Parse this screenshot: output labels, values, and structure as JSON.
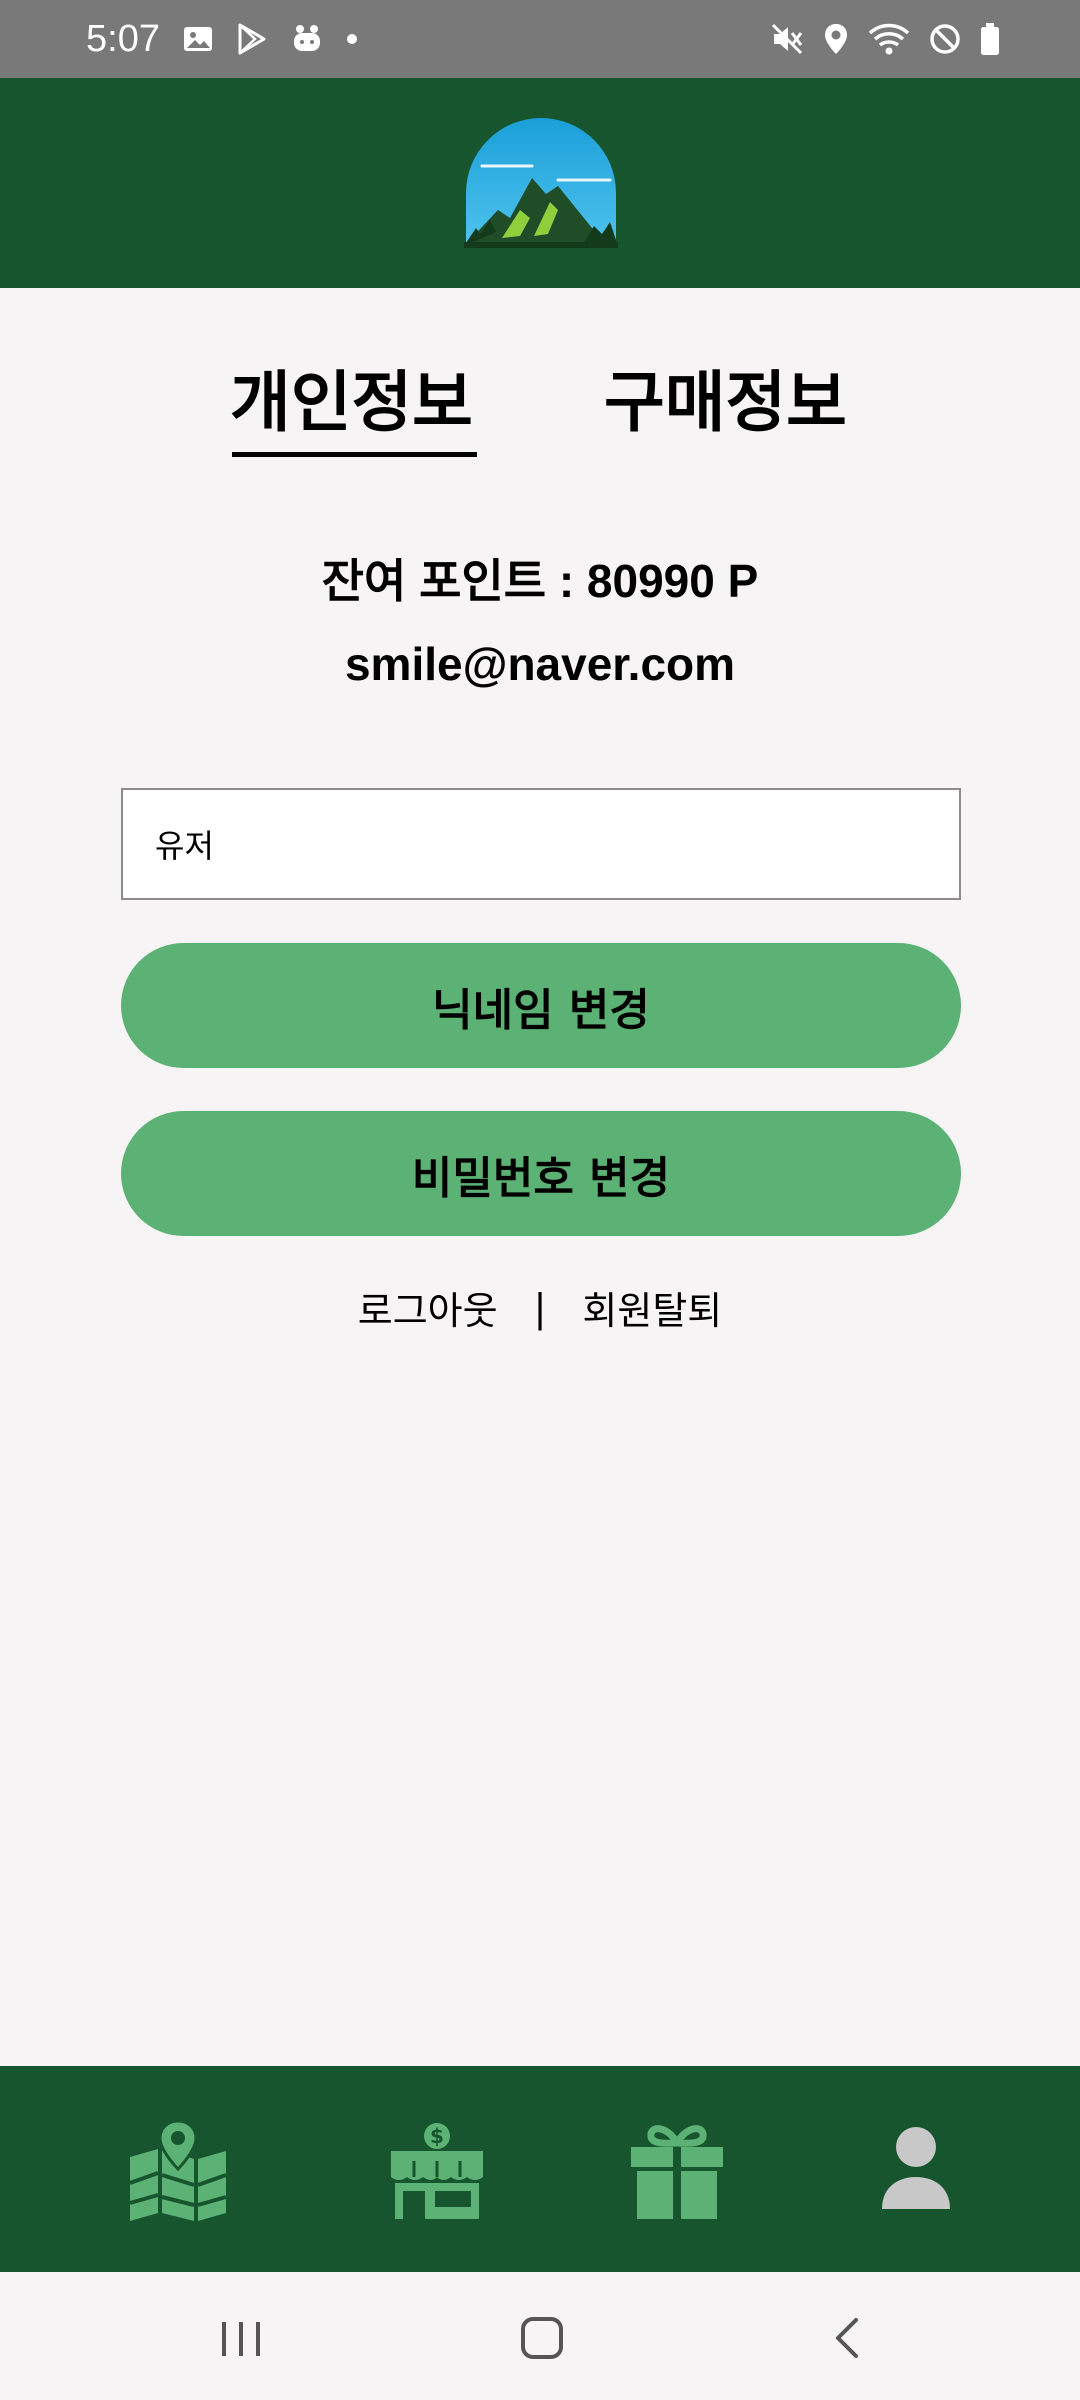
{
  "status_bar": {
    "time": "5:07",
    "left_icons": [
      "image-icon",
      "play-store-icon",
      "app-notification-icon",
      "dot-icon"
    ],
    "right_icons": [
      "mute-icon",
      "location-icon",
      "wifi-icon",
      "do-not-disturb-icon",
      "battery-icon"
    ]
  },
  "header": {
    "logo": "mountain-logo",
    "background_color": "#17552f"
  },
  "tabs": [
    {
      "label": "개인정보",
      "active": true
    },
    {
      "label": "구매정보",
      "active": false
    }
  ],
  "profile": {
    "points_text": "잔여 포인트 : 80990 P",
    "email": "smile@naver.com"
  },
  "nickname_input": {
    "value": "유저"
  },
  "buttons": {
    "change_nickname": "닉네임 변경",
    "change_password": "비밀번호 변경",
    "color": "#5cb274"
  },
  "links": {
    "logout": "로그아웃",
    "separator": "|",
    "withdraw": "회원탈퇴"
  },
  "bottom_nav": {
    "items": [
      "map-icon",
      "store-icon",
      "gift-icon",
      "profile-icon"
    ],
    "active": "profile-icon",
    "icon_color": "#5cb274",
    "active_icon_color": "#c8c8c8"
  },
  "system_nav": [
    "recent-apps-icon",
    "home-icon",
    "back-icon"
  ]
}
